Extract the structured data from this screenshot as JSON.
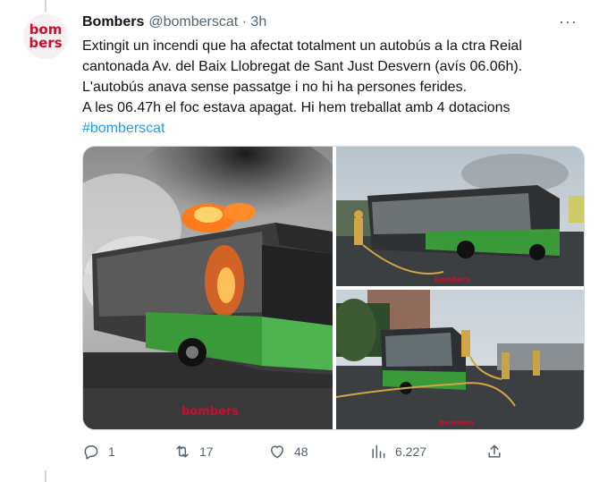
{
  "tweet": {
    "author_name": "Bombers",
    "author_handle": "@bomberscat · 3h",
    "avatar_line1": "bom",
    "avatar_line2": "bers",
    "text_lines": [
      "Extingit un incendi que ha afectat totalment un autobús a la ctra Reial",
      "cantonada Av. del Baix Llobregat de Sant Just Desvern (avís 06.06h).",
      "L'autobús anava sense passatge i no hi ha persones ferides.",
      "A les 06.47h el foc estava apagat. Hi hem treballat amb 4 dotacions"
    ],
    "hashtag": "#bomberscat",
    "more_label": "···",
    "photo_watermark": "bombers"
  },
  "actions": {
    "replies": "1",
    "retweets": "17",
    "likes": "48",
    "views": "6.227"
  },
  "icons": {
    "reply": "reply-icon",
    "retweet": "retweet-icon",
    "like": "heart-icon",
    "views": "views-icon",
    "share": "share-icon",
    "more": "more-icon"
  },
  "colors": {
    "brand": "#c8102e",
    "link": "#1d9bf0",
    "secondary_text": "#536471",
    "bus_green": "#3a9a3a"
  }
}
